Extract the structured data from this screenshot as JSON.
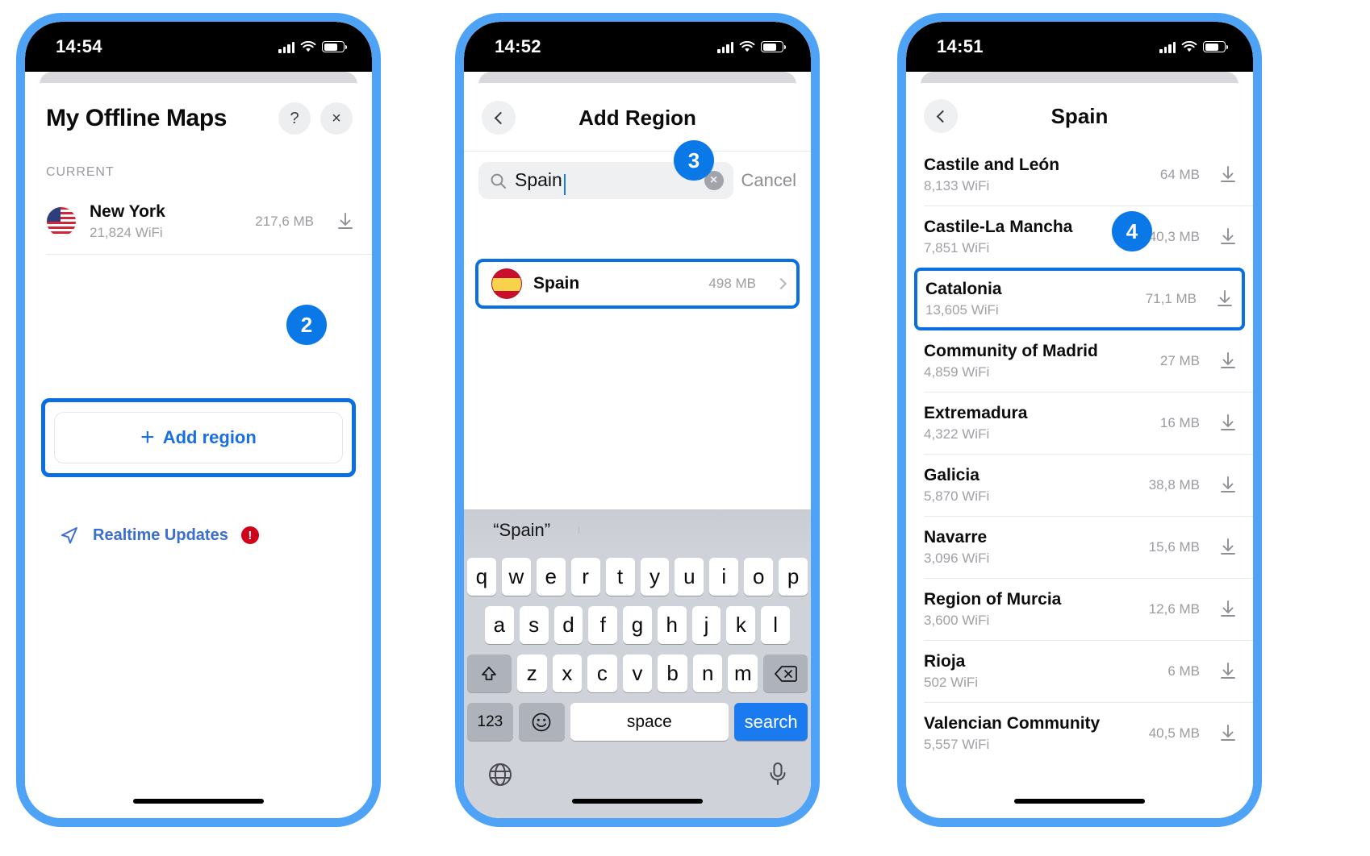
{
  "theme": {
    "accent_blue": "#0b6fe0",
    "frame_blue": "#4FA3F7",
    "step_badge_blue": "#0b78e8",
    "link_blue": "#1a6fe0",
    "alert_red": "#d0021b",
    "muted_grey": "#9b9ba1"
  },
  "phone1": {
    "status": {
      "time": "14:54"
    },
    "title": "My Offline Maps",
    "help_label": "?",
    "close_label": "×",
    "section_label": "CURRENT",
    "current_maps": [
      {
        "name": "New York",
        "wifi": "21,824 WiFi",
        "size": "217,6 MB",
        "flag": "us-flag-icon"
      }
    ],
    "add_region_label": "Add region",
    "add_region_plus": "+",
    "realtime_label": "Realtime Updates",
    "realtime_badge": "!",
    "step_badge": "2"
  },
  "phone2": {
    "status": {
      "time": "14:52"
    },
    "nav_title": "Add Region",
    "search": {
      "value": "Spain",
      "placeholder": "Search",
      "clear_label": "×"
    },
    "cancel_label": "Cancel",
    "results": [
      {
        "name": "Spain",
        "size": "498 MB",
        "flag": "es-flag-icon"
      }
    ],
    "step_badge": "3",
    "keyboard": {
      "predictions": [
        "“Spain”",
        "",
        ""
      ],
      "row1": [
        "q",
        "w",
        "e",
        "r",
        "t",
        "y",
        "u",
        "i",
        "o",
        "p"
      ],
      "row2": [
        "a",
        "s",
        "d",
        "f",
        "g",
        "h",
        "j",
        "k",
        "l"
      ],
      "row3": [
        "z",
        "x",
        "c",
        "v",
        "b",
        "n",
        "m"
      ],
      "shift_label": "⇧",
      "backspace_label": "⌫",
      "numbers_label": "123",
      "emoji_label": "☺",
      "space_label": "space",
      "search_label": "search",
      "globe_label": "⊕",
      "mic_label": "⒬"
    }
  },
  "phone3": {
    "status": {
      "time": "14:51"
    },
    "nav_title": "Spain",
    "step_badge": "4",
    "regions": [
      {
        "name": "Castile and León",
        "wifi": "8,133 WiFi",
        "size": "64 MB"
      },
      {
        "name": "Castile-La Mancha",
        "wifi": "7,851 WiFi",
        "size": "40,3 MB"
      },
      {
        "name": "Catalonia",
        "wifi": "13,605 WiFi",
        "size": "71,1 MB"
      },
      {
        "name": "Community of Madrid",
        "wifi": "4,859 WiFi",
        "size": "27 MB"
      },
      {
        "name": "Extremadura",
        "wifi": "4,322 WiFi",
        "size": "16 MB"
      },
      {
        "name": "Galicia",
        "wifi": "5,870 WiFi",
        "size": "38,8 MB"
      },
      {
        "name": "Navarre",
        "wifi": "3,096 WiFi",
        "size": "15,6 MB"
      },
      {
        "name": "Region of Murcia",
        "wifi": "3,600 WiFi",
        "size": "12,6 MB"
      },
      {
        "name": "Rioja",
        "wifi": "502 WiFi",
        "size": "6 MB"
      },
      {
        "name": "Valencian Community",
        "wifi": "5,557 WiFi",
        "size": "40,5 MB"
      }
    ],
    "highlighted_index": 2
  }
}
